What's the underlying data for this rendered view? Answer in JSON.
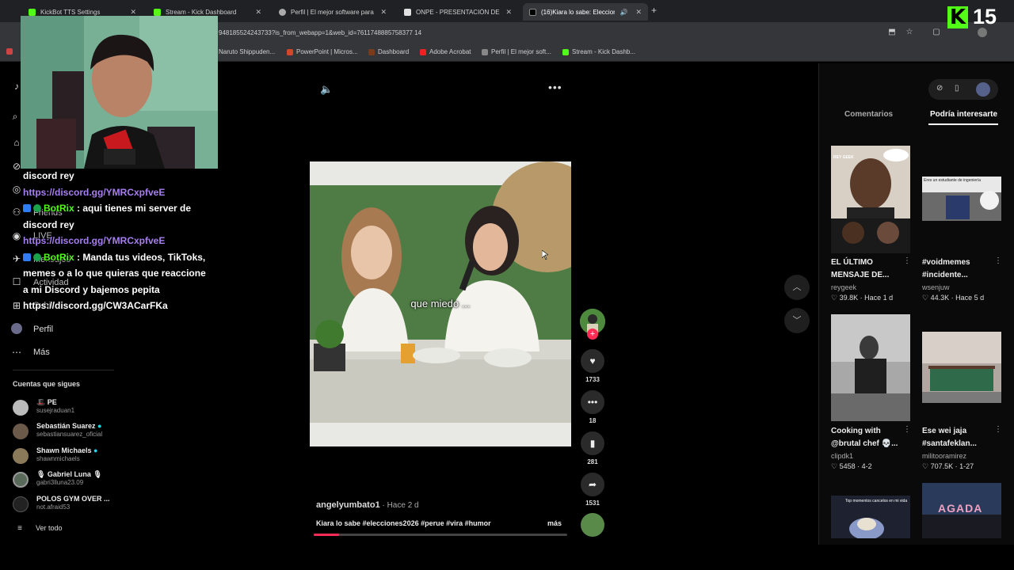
{
  "browser": {
    "tabs": [
      {
        "label": "KickBot TTS Settings",
        "active": false
      },
      {
        "label": "Stream - Kick Dashboard",
        "active": false
      },
      {
        "label": "Perfil | El mejor software para p",
        "active": false
      },
      {
        "label": "ONPE - PRESENTACIÓN DE RES",
        "active": false
      },
      {
        "label": "(16)Kiara lo sabe: Eleccione",
        "active": true
      }
    ],
    "new_tab": "+",
    "url": "948185524243733?is_from_webapp=1&web_id=7611748885758377 14",
    "bookmarks": [
      "Naruto Shippuden...",
      "PowerPoint | Micros...",
      "Dashboard",
      "Adobe Acrobat",
      "Perfil | El mejor soft...",
      "Stream - Kick Dashb..."
    ]
  },
  "overlay": {
    "kick_logo": "K",
    "viewer_count": "15"
  },
  "nav": {
    "items": [
      {
        "label": "Friends",
        "icon": "friends-icon"
      },
      {
        "label": "LIVE",
        "icon": "live-icon"
      },
      {
        "label": "Mensajes",
        "icon": "messages-icon"
      },
      {
        "label": "Actividad",
        "icon": "activity-icon"
      },
      {
        "label": "Subir",
        "icon": "upload-icon"
      },
      {
        "label": "Perfil",
        "icon": "profile-icon"
      },
      {
        "label": "Más",
        "icon": "more-icon"
      }
    ],
    "following_title": "Cuentas que sigues",
    "following": [
      {
        "name": "🎩 PE",
        "handle": "susejraduan1"
      },
      {
        "name": "Sebastián Suarez",
        "handle": "sebastiansuarez_oficial"
      },
      {
        "name": "Shawn Michaels",
        "handle": "shawnmichaels"
      },
      {
        "name": "🎙 Gabriel Luna 🎙",
        "handle": "gabri3lluna23.09"
      },
      {
        "name": "POLOS GYM OVER ...",
        "handle": "not.afraid53"
      }
    ],
    "see_all": "Ver todo"
  },
  "chat": {
    "lines": {
      "l1": "discord rey",
      "l2": "https://discord.gg/YMRCxpfveE",
      "u1": "BotRix",
      "m1a": " : aqui tienes mi server de",
      "m1b": "discord rey",
      "l3": "https://discord.gg/YMRCxpfveE",
      "u2": "BotRix",
      "m2a": " : Manda tus videos, TikToks,",
      "m2b": "memes o a lo que quieras que reaccione",
      "m2c": "a mi Discord y bajemos pepita",
      "l4": "https://discord.gg/CW3ACarFKa"
    }
  },
  "video": {
    "caption": "que miedo ...",
    "author": "angelyumbato1",
    "posted": " · Hace 2 d",
    "description": "Kiara lo sabe #elecciones2026 #perue #vira #humor",
    "more": "más",
    "progress": 0.1,
    "likes": "1733",
    "comments": "18",
    "saves": "281",
    "shares": "1531"
  },
  "right_panel": {
    "tabs": [
      "Comentarios",
      "Podría interesarte"
    ],
    "active_tab": "Podría interesarte",
    "items": [
      {
        "title": "EL ÚLTIMO MENSAJE DE...",
        "user": "reygeek",
        "likes": "39.8K",
        "ago": "Hace 1 d",
        "thumb_text": "REY GEEK"
      },
      {
        "title": "#voidmemes #incidente...",
        "user": "wsenjuw",
        "likes": "44.3K",
        "ago": "Hace 5 d",
        "thumb_text": "Eres un estudiante de ingeniería"
      },
      {
        "title": "Cooking with @brutal chef 💀...",
        "user": "clipdk1",
        "likes": "5458",
        "ago": "4-2",
        "thumb_text": ""
      },
      {
        "title": "Ese wei jaja #santafeklan...",
        "user": "militooramirez",
        "likes": "707.5K",
        "ago": "1-27",
        "thumb_text": ""
      },
      {
        "title": "",
        "user": "",
        "likes": "",
        "ago": "",
        "thumb_text": "Top momentos cancelos en mi vida"
      },
      {
        "title": "",
        "user": "",
        "likes": "",
        "ago": "",
        "thumb_text": "AGADA"
      }
    ]
  },
  "colors": {
    "kick_green": "#53fc18",
    "tiktok_red": "#fe2c55",
    "chat_link": "#a77ef0"
  }
}
